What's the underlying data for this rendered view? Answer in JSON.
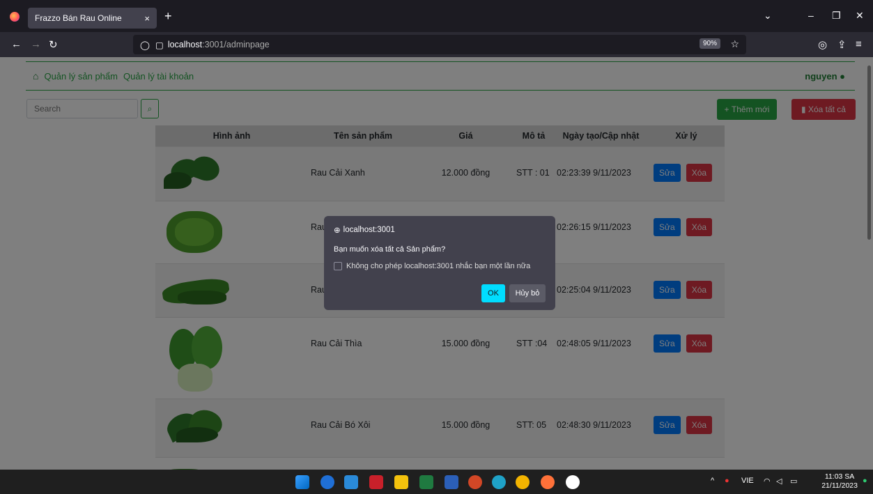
{
  "browser": {
    "tab_title": "Frazzo Bán Rau Online",
    "tab_close": "×",
    "new_tab": "+",
    "url_host": "localhost",
    "url_path": ":3001/adminpage",
    "zoom": "90%"
  },
  "nav": {
    "link1": "Quản lý sản phẩm",
    "link2": "Quản lý tài khoản",
    "user": "nguyen"
  },
  "toolbar": {
    "search_placeholder": "Search",
    "add_label": "Thêm mới",
    "delete_all_label": "Xóa tất cả"
  },
  "table": {
    "headers": [
      "Hình ảnh",
      "Tên sản phẩm",
      "Giá",
      "Mô tả",
      "Ngày tạo/Cập nhật",
      "Xử lý"
    ],
    "rows": [
      {
        "name": "Rau Cải Xanh",
        "price": "12.000 đồng",
        "desc": "STT : 01",
        "date": "02:23:39 9/11/2023"
      },
      {
        "name": "Rau",
        "price": "",
        "desc": "",
        "date": "02:26:15 9/11/2023"
      },
      {
        "name": "Rau",
        "price": "",
        "desc": "",
        "date": "02:25:04 9/11/2023"
      },
      {
        "name": "Rau Cải Thìa",
        "price": "15.000 đồng",
        "desc": "STT :04",
        "date": "02:48:05 9/11/2023"
      },
      {
        "name": "Rau Cải Bó Xôi",
        "price": "15.000 đồng",
        "desc": "STT: 05",
        "date": "02:48:30 9/11/2023"
      }
    ],
    "edit_label": "Sửa",
    "delete_label": "Xóa"
  },
  "dialog": {
    "host": "localhost:3001",
    "message": "Bạn muốn xóa tất cả Sản phẩm?",
    "checkbox_label": "Không cho phép localhost:3001 nhắc bạn một lần nữa",
    "ok": "OK",
    "cancel": "Hủy bỏ"
  },
  "taskbar": {
    "lang": "VIE",
    "time": "11:03 SA",
    "date": "21/11/2023"
  }
}
